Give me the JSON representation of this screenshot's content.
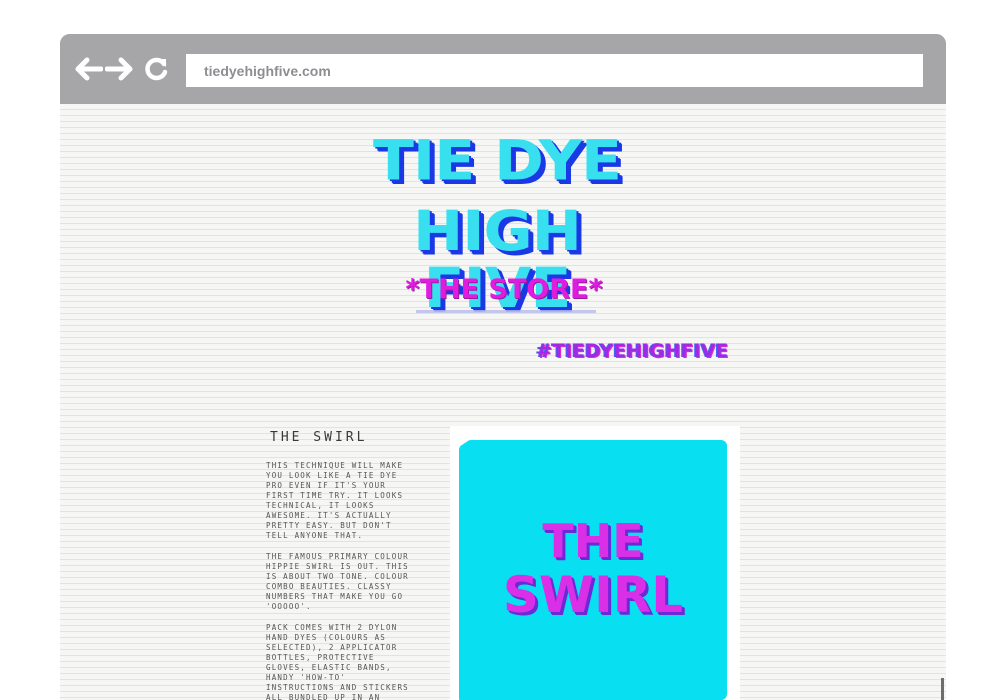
{
  "browser": {
    "url": "tiedyehighfive.com",
    "back_icon": "arrow-left-icon",
    "forward_icon": "arrow-right-icon",
    "reload_icon": "reload-icon"
  },
  "header": {
    "logo_line1": "TIE DYE",
    "logo_line2": "HIGH FIVE",
    "store_label": "*THE STORE*",
    "hashtag": "#TIEDYEHIGHFIVE"
  },
  "product": {
    "title": "THE SWIRL",
    "paragraphs": [
      "This technique will make you look like a tie dye pro even if it's your first time try. It looks technical, it looks awesome. It's actually pretty easy. But don't tell anyone that.",
      "The famous primary colour hippie swirl is out. This is about two tone. Colour combo beauties. Classy numbers that make you go 'ooooo'.",
      "Pack comes with 2 Dylon hand dyes (colours as selected), 2 applicator bottles, protective gloves, elastic bands, handy 'how-to' instructions and stickers all bundled up in an"
    ],
    "image_line1": "THE",
    "image_line2": "SWIRL"
  },
  "colors": {
    "logo_cyan": "#38e0ef",
    "logo_blue": "#1a38e6",
    "store_magenta": "#e11ce1",
    "swatch_cyan": "#08e0f2",
    "swatch_text": "#d92fe6"
  }
}
